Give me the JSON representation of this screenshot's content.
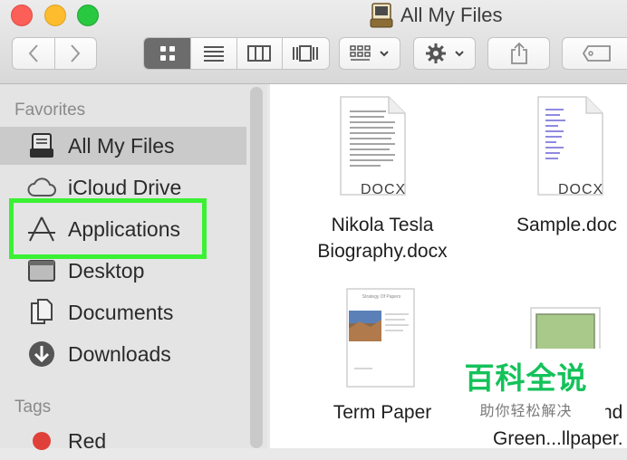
{
  "window": {
    "title": "All My Files"
  },
  "sidebar": {
    "favorites_header": "Favorites",
    "items": [
      {
        "label": "All My Files",
        "icon": "all-files-icon"
      },
      {
        "label": "iCloud Drive",
        "icon": "cloud-icon"
      },
      {
        "label": "Applications",
        "icon": "applications-icon"
      },
      {
        "label": "Desktop",
        "icon": "desktop-icon"
      },
      {
        "label": "Documents",
        "icon": "documents-icon"
      },
      {
        "label": "Downloads",
        "icon": "downloads-icon"
      }
    ],
    "tags_header": "Tags",
    "tags": [
      {
        "label": "Red",
        "color": "#e0403a"
      }
    ]
  },
  "files": [
    {
      "name_line1": "Nikola Tesla",
      "name_line2": "Biography.docx",
      "badge": "DOCX"
    },
    {
      "name_line1": "Sample.doc",
      "name_line2": "",
      "badge": "DOCX"
    },
    {
      "name_line1": "Term Paper",
      "name_line2": "",
      "badge": ""
    },
    {
      "name_line1": "nd",
      "name_line2": "Green...llpaper.",
      "badge": ""
    }
  ],
  "term_paper_preview": {
    "heading": "Strategy Of Papers"
  },
  "watermark": {
    "title": "百科全说",
    "subtitle": "助你轻松解决"
  },
  "colors": {
    "highlight": "#3af134",
    "selected_row": "#cacaca",
    "watermark_green": "#14c25a"
  }
}
